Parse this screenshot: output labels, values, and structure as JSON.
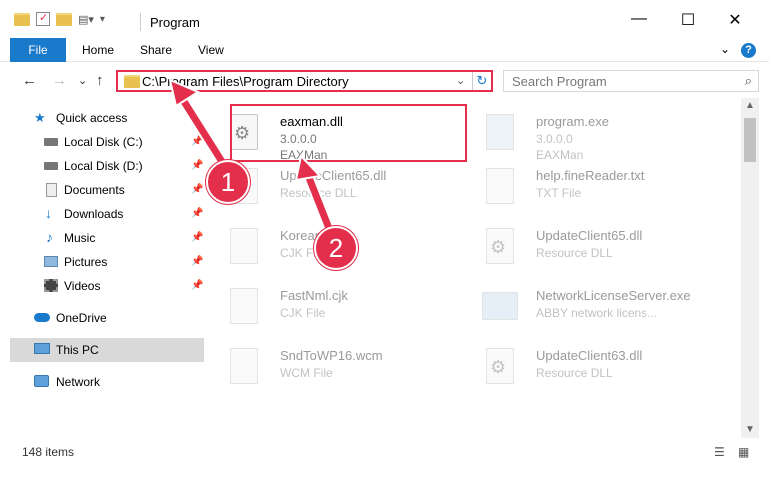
{
  "window": {
    "title": "Program",
    "minimize": "—",
    "maximize": "☐",
    "close": "✕"
  },
  "ribbon": {
    "file": "File",
    "home": "Home",
    "share": "Share",
    "view": "View",
    "expand": "⌄",
    "help": "?"
  },
  "nav": {
    "back": "←",
    "forward": "→",
    "recent": "⌄",
    "up": "↑",
    "address": "C:\\Program Files\\Program Directory",
    "address_dropdown": "⌄",
    "refresh": "↻",
    "search_placeholder": "Search Program",
    "search_icon": "⌕"
  },
  "sidebar": {
    "items": [
      {
        "label": "Quick access",
        "icon": "star-icon",
        "pinned": false
      },
      {
        "label": "Local Disk (C:)",
        "icon": "drive-icon",
        "pinned": true
      },
      {
        "label": "Local Disk (D:)",
        "icon": "drive-icon",
        "pinned": true
      },
      {
        "label": "Documents",
        "icon": "documents-icon",
        "pinned": true
      },
      {
        "label": "Downloads",
        "icon": "download-icon",
        "pinned": true
      },
      {
        "label": "Music",
        "icon": "music-icon",
        "pinned": true
      },
      {
        "label": "Pictures",
        "icon": "pictures-icon",
        "pinned": true
      },
      {
        "label": "Videos",
        "icon": "videos-icon",
        "pinned": true
      },
      {
        "label": "OneDrive",
        "icon": "cloud-icon",
        "pinned": false
      },
      {
        "label": "This PC",
        "icon": "computer-icon",
        "pinned": false,
        "selected": true
      },
      {
        "label": "Network",
        "icon": "network-icon",
        "pinned": false
      }
    ]
  },
  "files": [
    {
      "name": "eaxman.dll",
      "line1": "3.0.0.0",
      "line2": "EAXMan",
      "highlighted": true
    },
    {
      "name": "program.exe",
      "line1": "3.0.0.0",
      "line2": "EAXMan"
    },
    {
      "name": "UpdateClient65.dll",
      "line1": "Resource DLL",
      "line2": ""
    },
    {
      "name": "help.fineReader.txt",
      "line1": "TXT File",
      "line2": ""
    },
    {
      "name": "Korean",
      "line1": "CJK File",
      "line2": ""
    },
    {
      "name": "UpdateClient65.dll",
      "line1": "Resource DLL",
      "line2": ""
    },
    {
      "name": "FastNml.cjk",
      "line1": "CJK File",
      "line2": ""
    },
    {
      "name": "NetworkLicenseServer.exe",
      "line1": "ABBY network licens...",
      "line2": ""
    },
    {
      "name": "SndToWP16.wcm",
      "line1": "WCM File",
      "line2": ""
    },
    {
      "name": "UpdateClient63.dll",
      "line1": "Resource DLL",
      "line2": ""
    }
  ],
  "status": {
    "count": "148 items"
  },
  "callouts": {
    "one": "1",
    "two": "2"
  },
  "colors": {
    "accent": "#1979ca",
    "highlight": "#e32f4b",
    "selected_bg": "#d9d9d9"
  }
}
